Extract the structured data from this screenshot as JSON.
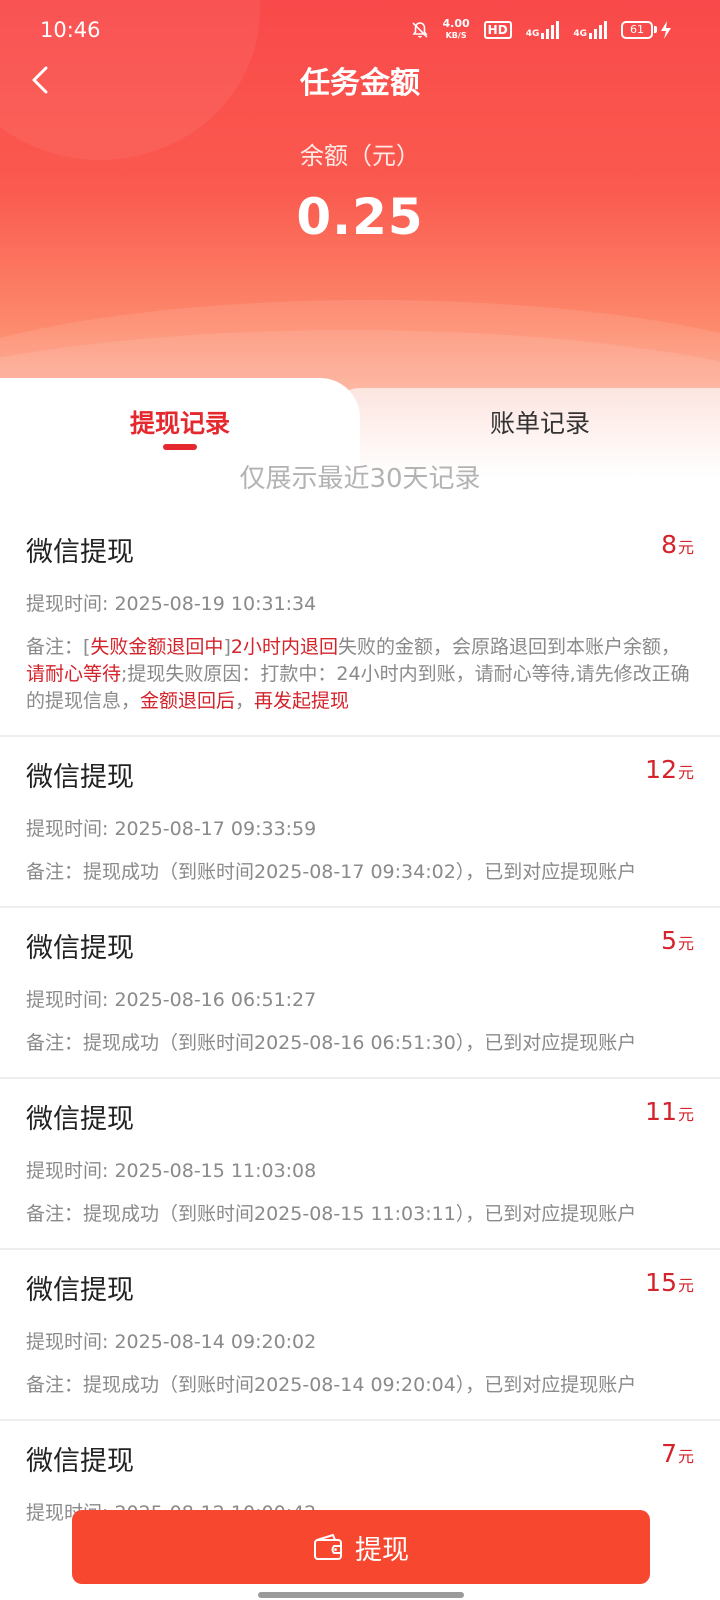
{
  "status_bar": {
    "time": "10:46",
    "net_speed_value": "4.00",
    "net_speed_unit": "KB/S",
    "hd_label": "HD",
    "signal1": "4G",
    "signal2": "4G",
    "battery": "61"
  },
  "header": {
    "title": "任务金额",
    "balance_label": "余额（元）",
    "balance_value": "0.25"
  },
  "tabs": [
    {
      "label": "提现记录",
      "active": true
    },
    {
      "label": "账单记录",
      "active": false
    }
  ],
  "notice": "仅展示最近30天记录",
  "currency_unit": "元",
  "note_prefix": "备注：",
  "records": [
    {
      "title": "微信提现",
      "amount": "8",
      "time": "提现时间: 2025-08-19 10:31:34",
      "note_segments": [
        {
          "text": "备注：[",
          "highlight": false
        },
        {
          "text": "失败金额退回中",
          "highlight": true
        },
        {
          "text": "]",
          "highlight": false
        },
        {
          "text": "2小时内退回",
          "highlight": true
        },
        {
          "text": "失败的金额，会原路退回到本账户余额，",
          "highlight": false
        },
        {
          "text": "请耐心等待",
          "highlight": true
        },
        {
          "text": ";提现失败原因：打款中：24小时内到账，请耐心等待,请先修改正确的提现信息，",
          "highlight": false
        },
        {
          "text": "金额退回后",
          "highlight": true
        },
        {
          "text": "，",
          "highlight": false
        },
        {
          "text": "再发起提现",
          "highlight": true
        }
      ]
    },
    {
      "title": "微信提现",
      "amount": "12",
      "time": "提现时间: 2025-08-17 09:33:59",
      "note": "备注：提现成功（到账时间2025-08-17 09:34:02），已到对应提现账户"
    },
    {
      "title": "微信提现",
      "amount": "5",
      "time": "提现时间: 2025-08-16 06:51:27",
      "note": "备注：提现成功（到账时间2025-08-16 06:51:30），已到对应提现账户"
    },
    {
      "title": "微信提现",
      "amount": "11",
      "time": "提现时间: 2025-08-15 11:03:08",
      "note": "备注：提现成功（到账时间2025-08-15 11:03:11），已到对应提现账户"
    },
    {
      "title": "微信提现",
      "amount": "15",
      "time": "提现时间: 2025-08-14 09:20:02",
      "note": "备注：提现成功（到账时间2025-08-14 09:20:04），已到对应提现账户"
    },
    {
      "title": "微信提现",
      "amount": "7",
      "time": "提现时间: 2025-08-12 10:00:42"
    }
  ],
  "withdraw_button": {
    "label": "提现",
    "icon": "wallet-icon"
  },
  "colors": {
    "accent_red": "#e5282d",
    "amount_red": "#d4232b",
    "button_bg": "#f7472e"
  }
}
